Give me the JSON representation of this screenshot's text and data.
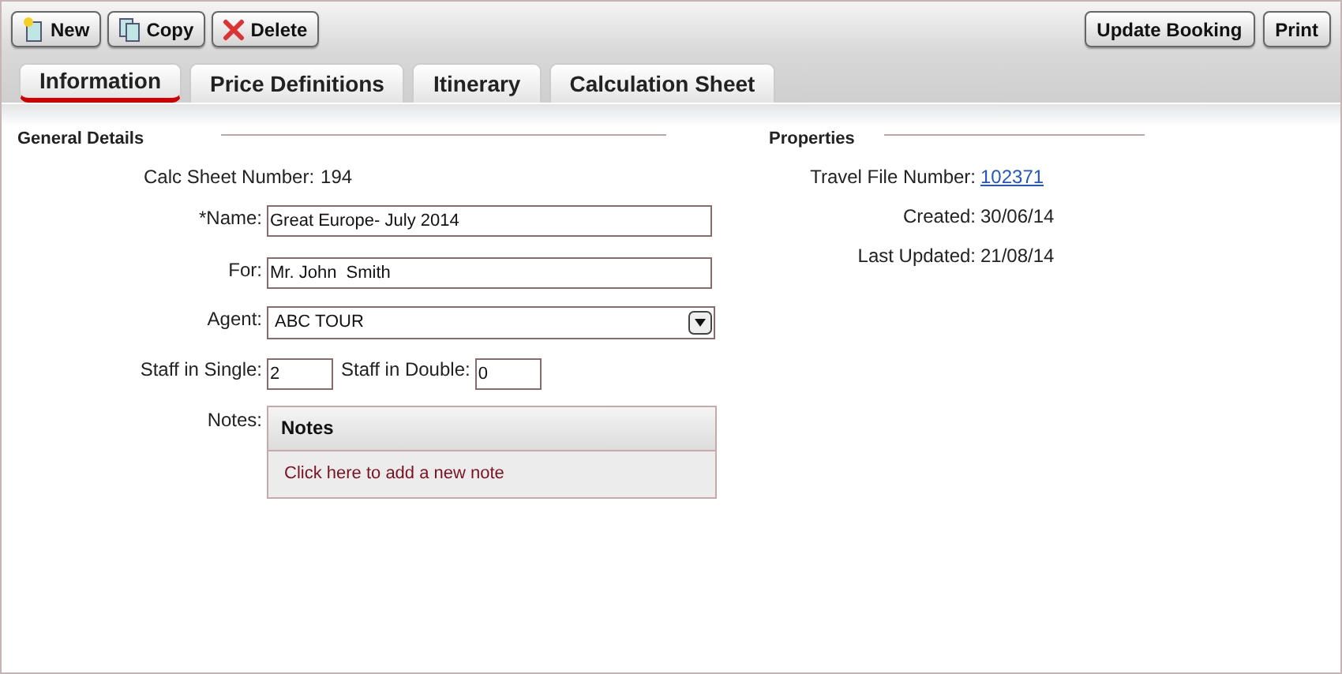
{
  "toolbar": {
    "left_buttons": [
      {
        "label": "New",
        "kind": "new"
      },
      {
        "label": "Copy",
        "kind": "copy"
      },
      {
        "label": "Delete",
        "kind": "delete"
      }
    ],
    "right_buttons": [
      {
        "label": "Update Booking"
      },
      {
        "label": "Print"
      }
    ]
  },
  "tabs": [
    {
      "label": "Information",
      "selected": true
    },
    {
      "label": "Price Definitions",
      "selected": false
    },
    {
      "label": "Itinerary",
      "selected": false
    },
    {
      "label": "Calculation Sheet",
      "selected": false
    }
  ],
  "general_details": {
    "title": "General Details",
    "calc_sheet_label": "Calc Sheet Number:",
    "calc_sheet_value": "194",
    "name_label": "*Name:",
    "name_value": "Great Europe- July 2014",
    "for_label": "For:",
    "for_value": "Mr. John  Smith",
    "agent_label": "Agent:",
    "agent_value": "ABC TOUR",
    "single_label": "Staff in Single:",
    "single_value": "2",
    "double_label": "Staff in Double:",
    "double_value": "0",
    "notes_label": "Notes:",
    "notes_title": "Notes",
    "notes_link": "Click here to add a new note"
  },
  "properties": {
    "title": "Properties",
    "rows": [
      {
        "label": "Travel File Number:",
        "value": "102371",
        "kind": "link"
      },
      {
        "label": "Created:",
        "value": "30/06/14",
        "kind": "text"
      },
      {
        "label": "Last Updated:",
        "value": "21/08/14",
        "kind": "text"
      }
    ]
  }
}
